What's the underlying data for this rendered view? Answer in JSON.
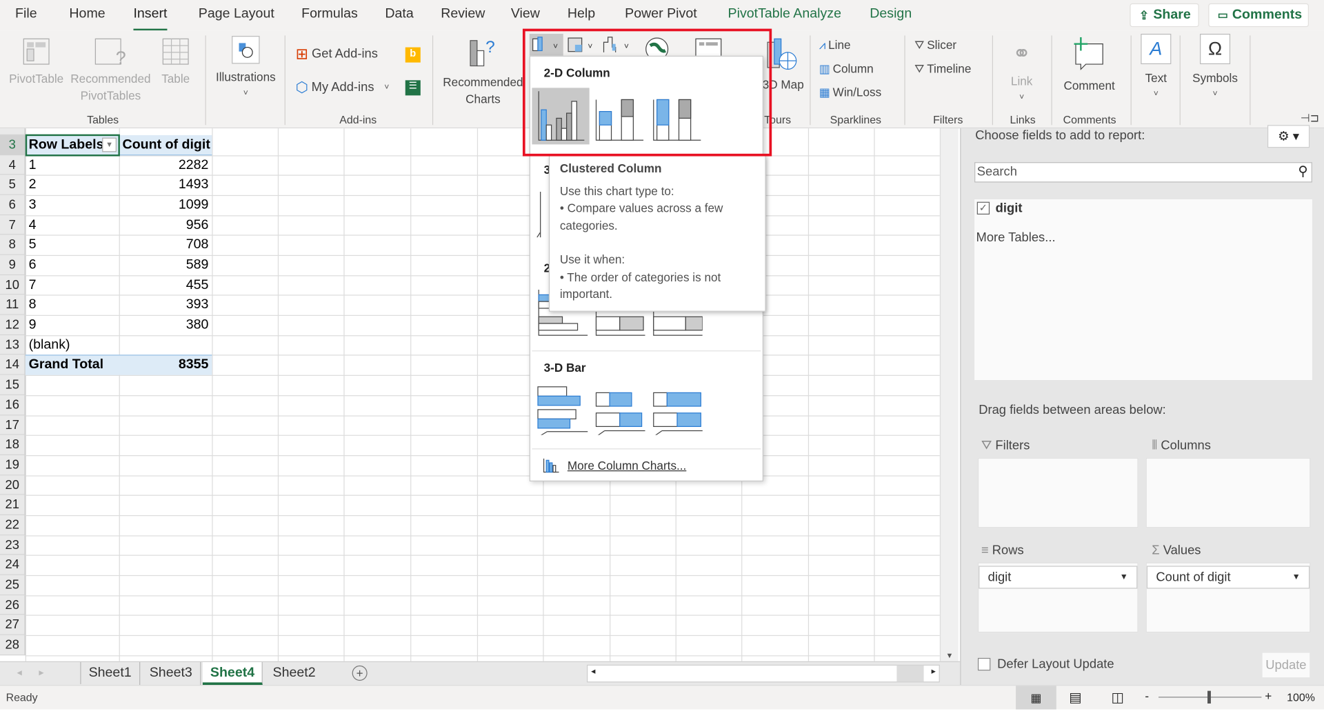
{
  "ribbon_tabs": [
    {
      "label": "File"
    },
    {
      "label": "Home"
    },
    {
      "label": "Insert",
      "active": true
    },
    {
      "label": "Page Layout"
    },
    {
      "label": "Formulas"
    },
    {
      "label": "Data"
    },
    {
      "label": "Review"
    },
    {
      "label": "View"
    },
    {
      "label": "Help"
    },
    {
      "label": "Power Pivot"
    },
    {
      "label": "PivotTable Analyze"
    },
    {
      "label": "Design"
    }
  ],
  "top_buttons": {
    "share": "Share",
    "comments": "Comments"
  },
  "ribbon": {
    "pivottable": "PivotTable",
    "recommended_pivottables": "Recommended PivotTables",
    "table": "Table",
    "group_tables": "Tables",
    "illustrations": "Illustrations",
    "get_addins": "Get Add-ins",
    "my_addins": "My Add-ins",
    "group_addins": "Add-ins",
    "recommended_charts": "Recommended Charts",
    "map3d": "3D Map",
    "group_tours": "Tours",
    "line": "Line",
    "column": "Column",
    "winloss": "Win/Loss",
    "group_sparklines": "Sparklines",
    "slicer": "Slicer",
    "timeline": "Timeline",
    "group_filters": "Filters",
    "link": "Link",
    "group_links": "Links",
    "comment": "Comment",
    "group_comments": "Comments",
    "text": "Text",
    "symbols": "Symbols"
  },
  "sheet": {
    "row_numbers": [
      "3",
      "4",
      "5",
      "6",
      "7",
      "8",
      "9",
      "10",
      "11",
      "12",
      "13",
      "14",
      "15",
      "16",
      "17",
      "18",
      "19",
      "20",
      "21",
      "22",
      "23",
      "24",
      "25",
      "26",
      "27",
      "28"
    ],
    "pivot": {
      "header_rows": "Row Labels",
      "header_values": "Count of digit",
      "rows": [
        {
          "label": "1",
          "value": "2282"
        },
        {
          "label": "2",
          "value": "1493"
        },
        {
          "label": "3",
          "value": "1099"
        },
        {
          "label": "4",
          "value": "956"
        },
        {
          "label": "5",
          "value": "708"
        },
        {
          "label": "6",
          "value": "589"
        },
        {
          "label": "7",
          "value": "455"
        },
        {
          "label": "8",
          "value": "393"
        },
        {
          "label": "9",
          "value": "380"
        },
        {
          "label": "(blank)",
          "value": ""
        }
      ],
      "total_label": "Grand Total",
      "total_value": "8355"
    }
  },
  "chart_menu": {
    "section_2d_column": "2-D Column",
    "section_3d_column_partial": "3",
    "section_2d_bar_partial": "2",
    "section_3d_bar": "3-D Bar",
    "more": "More Column Charts...",
    "tooltip": {
      "title": "Clustered Column",
      "line1": "Use this chart type to:",
      "line2": "• Compare values across a few categories.",
      "line3": "Use it when:",
      "line4": "• The order of categories is not important."
    }
  },
  "sheet_tabs": [
    {
      "label": "Sheet1"
    },
    {
      "label": "Sheet3"
    },
    {
      "label": "Sheet4",
      "active": true
    },
    {
      "label": "Sheet2"
    }
  ],
  "status": {
    "ready": "Ready",
    "zoom": "100%"
  },
  "field_pane": {
    "choose": "Choose fields to add to report:",
    "search_placeholder": "Search",
    "fields": [
      {
        "label": "digit",
        "checked": true
      }
    ],
    "more_tables": "More Tables...",
    "drag": "Drag fields between areas below:",
    "filters": "Filters",
    "columns": "Columns",
    "rows": "Rows",
    "values": "Values",
    "rows_value": "digit",
    "values_value": "Count of digit",
    "defer": "Defer Layout Update",
    "update": "Update"
  },
  "colors": {
    "accent": "#217346",
    "highlight": "#e81123",
    "pivot_header": "#ddebf7",
    "chart_blue": "#7ab5e8"
  }
}
